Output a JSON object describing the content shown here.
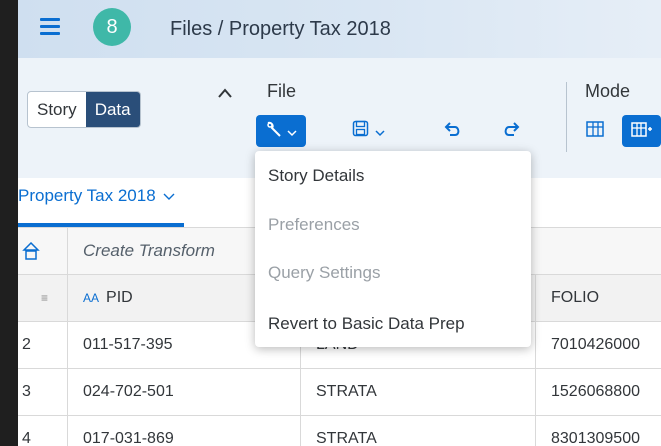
{
  "shell": {
    "avatar_initial": "8",
    "title": "Files / Property Tax 2018"
  },
  "toolbar": {
    "view_toggle": {
      "story": "Story",
      "data": "Data",
      "selected": "Data"
    },
    "file_label": "File",
    "mode_label": "Mode",
    "icons": {
      "collapse": "chevron-up-icon",
      "tools": "wrench-icon",
      "save": "save-icon",
      "undo": "undo-icon",
      "redo": "redo-icon",
      "mode_table": "table-icon",
      "mode_transform": "grid-transform-icon"
    }
  },
  "tab": {
    "label": "Property Tax 2018"
  },
  "transform_bar": {
    "placeholder": "Create Transform"
  },
  "table": {
    "headers": [
      "PID",
      "FOLIO"
    ],
    "rows": [
      {
        "num": "2",
        "pid": "011-517-395",
        "type": "LAND",
        "folio": "7010426000"
      },
      {
        "num": "3",
        "pid": "024-702-501",
        "type": "STRATA",
        "folio": "1526068800"
      },
      {
        "num": "4",
        "pid": "017-031-869",
        "type": "STRATA",
        "folio": "8301309500"
      }
    ]
  },
  "menu": {
    "items": [
      {
        "label": "Story Details",
        "enabled": true
      },
      {
        "label": "Preferences",
        "enabled": false
      },
      {
        "label": "Query Settings",
        "enabled": false
      },
      {
        "label": "Revert to Basic Data Prep",
        "enabled": true
      }
    ]
  },
  "colors": {
    "accent": "#0a6ed1",
    "toggle_active": "#2a4e79",
    "avatar": "#3fb8a8"
  }
}
